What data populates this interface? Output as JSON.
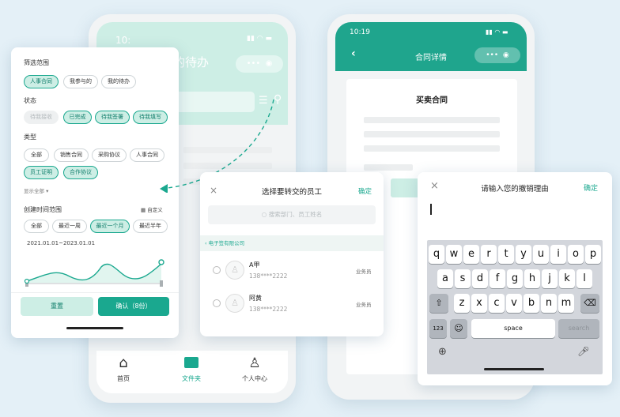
{
  "phone1": {
    "time": "10:",
    "title_fragment": "我的待办",
    "nav": [
      {
        "label": "首页",
        "icon": "home-icon",
        "active": false
      },
      {
        "label": "文件夹",
        "icon": "folder-icon",
        "active": true
      },
      {
        "label": "个人中心",
        "icon": "user-icon",
        "active": false
      }
    ]
  },
  "filter": {
    "scope_title": "筛选范围",
    "scope": [
      "人事合同",
      "我参与的",
      "我的待办"
    ],
    "status_title": "状态",
    "status": [
      "待我接收",
      "已完成",
      "待我签署",
      "待我填写"
    ],
    "type_title": "类型",
    "types": [
      "全部",
      "销售合同",
      "采购协议",
      "人事合同",
      "员工证明",
      "合作协议"
    ],
    "show_all": "显示全部",
    "time_title": "创建时间范围",
    "custom": "自定义",
    "time_opts": [
      "全部",
      "最近一周",
      "最近一个月",
      "最近半年"
    ],
    "date_range": "2021.01.01~2023.01.01",
    "reset": "重置",
    "confirm": "确认（8份）"
  },
  "phone2": {
    "time": "10:19",
    "title": "合同详情",
    "doc_title": "买卖合同"
  },
  "transfer": {
    "cancel_icon": "close-icon",
    "title": "选择要转交的员工",
    "confirm": "确定",
    "search_placeholder": "搜索部门、员工姓名",
    "dept": "电子签有限公司",
    "people": [
      {
        "name": "A甲",
        "phone": "138****2222",
        "role": "业务员"
      },
      {
        "name": "阿黄",
        "phone": "138****2222",
        "role": "业务员"
      }
    ]
  },
  "revoke": {
    "title": "请输入您的撤销理由",
    "confirm": "确定",
    "keys_row1": [
      "q",
      "w",
      "e",
      "r",
      "t",
      "y",
      "u",
      "i",
      "o",
      "p"
    ],
    "keys_row2": [
      "a",
      "s",
      "d",
      "f",
      "g",
      "h",
      "j",
      "k",
      "l"
    ],
    "keys_row3": [
      "z",
      "x",
      "c",
      "v",
      "b",
      "n",
      "m"
    ],
    "num": "123",
    "space": "space",
    "search": "search"
  },
  "colors": {
    "accent": "#1aa88f",
    "accent_light": "#cdeee5",
    "header": "#1fa58d"
  }
}
